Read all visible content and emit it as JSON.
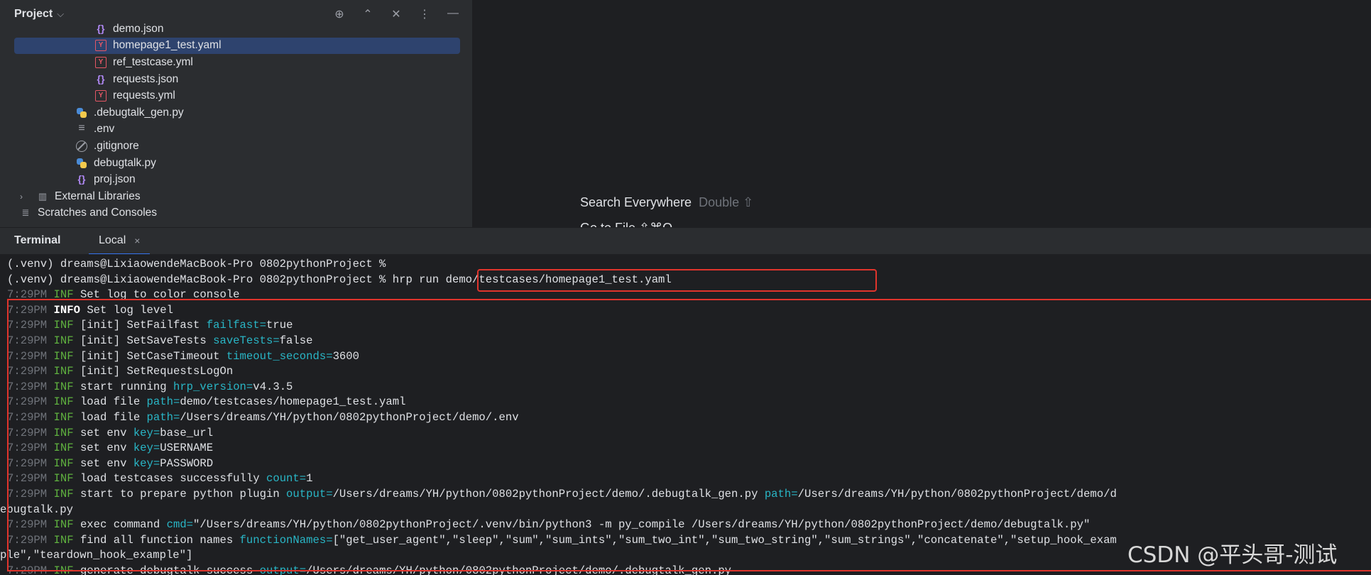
{
  "project": {
    "title": "Project",
    "chevron": "⌵",
    "toolbar_icons": [
      "target-icon",
      "expand-icon",
      "collapse-icon",
      "more-icon",
      "minimize-icon"
    ],
    "items": [
      {
        "label": "demo.json",
        "icon": "json-icon",
        "indent": 2
      },
      {
        "label": "homepage1_test.yaml",
        "icon": "yaml-icon",
        "indent": 2,
        "selected": true
      },
      {
        "label": "ref_testcase.yml",
        "icon": "yaml-icon",
        "indent": 2
      },
      {
        "label": "requests.json",
        "icon": "json-icon",
        "indent": 2
      },
      {
        "label": "requests.yml",
        "icon": "yaml-icon",
        "indent": 2
      },
      {
        "label": ".debugtalk_gen.py",
        "icon": "python-icon",
        "indent": 1
      },
      {
        "label": ".env",
        "icon": "env-icon",
        "indent": 1
      },
      {
        "label": ".gitignore",
        "icon": "gitignore-icon",
        "indent": 1
      },
      {
        "label": "debugtalk.py",
        "icon": "python-icon",
        "indent": 1
      },
      {
        "label": "proj.json",
        "icon": "json-icon",
        "indent": 1
      },
      {
        "label": "External Libraries",
        "icon": "library-icon",
        "indent": 0,
        "expandable": true
      },
      {
        "label": "Scratches and Consoles",
        "icon": "scratches-icon",
        "indent": 0
      }
    ]
  },
  "editor": {
    "search_everywhere": "Search Everywhere",
    "search_hint": "Double ⇧",
    "go_to_file": "Go to File  ⇧⌘O"
  },
  "terminal": {
    "title": "Terminal",
    "tab_label": "Local",
    "tab_close": "×",
    "prompt_lines": [
      "(.venv) dreams@LixiaowendeMacBook-Pro 0802pythonProject % ",
      "(.venv) dreams@LixiaowendeMacBook-Pro 0802pythonProject % hrp run demo/testcases/homepage1_test.yaml"
    ],
    "log_lines": [
      [
        [
          "t",
          "7:29PM "
        ],
        [
          "lv",
          "INF "
        ],
        [
          "n",
          "Set log to color console"
        ]
      ],
      [
        [
          "t",
          "7:29PM "
        ],
        [
          "lvb",
          "INFO "
        ],
        [
          "n",
          "Set log level"
        ]
      ],
      [
        [
          "t",
          "7:29PM "
        ],
        [
          "lv",
          "INF "
        ],
        [
          "n",
          "[init] SetFailfast "
        ],
        [
          "k",
          "failfast="
        ],
        [
          "n",
          "true"
        ]
      ],
      [
        [
          "t",
          "7:29PM "
        ],
        [
          "lv",
          "INF "
        ],
        [
          "n",
          "[init] SetSaveTests "
        ],
        [
          "k",
          "saveTests="
        ],
        [
          "n",
          "false"
        ]
      ],
      [
        [
          "t",
          "7:29PM "
        ],
        [
          "lv",
          "INF "
        ],
        [
          "n",
          "[init] SetCaseTimeout "
        ],
        [
          "k",
          "timeout_seconds="
        ],
        [
          "n",
          "3600"
        ]
      ],
      [
        [
          "t",
          "7:29PM "
        ],
        [
          "lv",
          "INF "
        ],
        [
          "n",
          "[init] SetRequestsLogOn"
        ]
      ],
      [
        [
          "t",
          "7:29PM "
        ],
        [
          "lv",
          "INF "
        ],
        [
          "n",
          "start running "
        ],
        [
          "k",
          "hrp_version="
        ],
        [
          "n",
          "v4.3.5"
        ]
      ],
      [
        [
          "t",
          "7:29PM "
        ],
        [
          "lv",
          "INF "
        ],
        [
          "n",
          "load file "
        ],
        [
          "k",
          "path="
        ],
        [
          "n",
          "demo/testcases/homepage1_test.yaml"
        ]
      ],
      [
        [
          "t",
          "7:29PM "
        ],
        [
          "lv",
          "INF "
        ],
        [
          "n",
          "load file "
        ],
        [
          "k",
          "path="
        ],
        [
          "n",
          "/Users/dreams/YH/python/0802pythonProject/demo/.env"
        ]
      ],
      [
        [
          "t",
          "7:29PM "
        ],
        [
          "lv",
          "INF "
        ],
        [
          "n",
          "set env "
        ],
        [
          "k",
          "key="
        ],
        [
          "n",
          "base_url"
        ]
      ],
      [
        [
          "t",
          "7:29PM "
        ],
        [
          "lv",
          "INF "
        ],
        [
          "n",
          "set env "
        ],
        [
          "k",
          "key="
        ],
        [
          "n",
          "USERNAME"
        ]
      ],
      [
        [
          "t",
          "7:29PM "
        ],
        [
          "lv",
          "INF "
        ],
        [
          "n",
          "set env "
        ],
        [
          "k",
          "key="
        ],
        [
          "n",
          "PASSWORD"
        ]
      ],
      [
        [
          "t",
          "7:29PM "
        ],
        [
          "lv",
          "INF "
        ],
        [
          "n",
          "load testcases successfully "
        ],
        [
          "k",
          "count="
        ],
        [
          "n",
          "1"
        ]
      ],
      [
        [
          "t",
          "7:29PM "
        ],
        [
          "lv",
          "INF "
        ],
        [
          "n",
          "start to prepare python plugin "
        ],
        [
          "k",
          "output="
        ],
        [
          "n",
          "/Users/dreams/YH/python/0802pythonProject/demo/.debugtalk_gen.py "
        ],
        [
          "k",
          "path="
        ],
        [
          "n",
          "/Users/dreams/YH/python/0802pythonProject/demo/d"
        ]
      ],
      [
        [
          "n",
          "ebugtalk.py"
        ]
      ],
      [
        [
          "t",
          "7:29PM "
        ],
        [
          "lv",
          "INF "
        ],
        [
          "n",
          "exec command "
        ],
        [
          "k",
          "cmd="
        ],
        [
          "n",
          "\"/Users/dreams/YH/python/0802pythonProject/.venv/bin/python3 -m py_compile /Users/dreams/YH/python/0802pythonProject/demo/debugtalk.py\""
        ]
      ],
      [
        [
          "t",
          "7:29PM "
        ],
        [
          "lv",
          "INF "
        ],
        [
          "n",
          "find all function names "
        ],
        [
          "k",
          "functionNames="
        ],
        [
          "n",
          "[\"get_user_agent\",\"sleep\",\"sum\",\"sum_ints\",\"sum_two_int\",\"sum_two_string\",\"sum_strings\",\"concatenate\",\"setup_hook_exam"
        ]
      ],
      [
        [
          "n",
          "ple\",\"teardown_hook_example\"]"
        ]
      ],
      [
        [
          "t",
          "7:29PM "
        ],
        [
          "lv",
          "INF "
        ],
        [
          "n",
          "generate debugtalk success "
        ],
        [
          "k",
          "output="
        ],
        [
          "n",
          "/Users/dreams/YH/python/0802pythonProject/demo/.debugtalk_gen.py"
        ]
      ]
    ]
  },
  "watermark": "CSDN @平头哥-测试"
}
